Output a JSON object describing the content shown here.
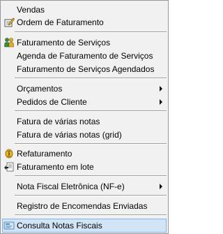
{
  "menu": {
    "items": [
      {
        "label": "Vendas"
      },
      {
        "label": "Ordem de Faturamento",
        "icon": "edit-document-icon"
      },
      {
        "label": "Faturamento de Serviços",
        "icon": "people-icon"
      },
      {
        "label": "Agenda de Faturamento de Serviços"
      },
      {
        "label": "Faturamento de Serviços Agendados"
      },
      {
        "label": "Orçamentos",
        "submenu": true
      },
      {
        "label": "Pedidos de Cliente",
        "submenu": true
      },
      {
        "label": "Fatura de várias notas"
      },
      {
        "label": "Fatura de várias notas (grid)"
      },
      {
        "label": "Refaturamento",
        "icon": "refresh-coin-icon"
      },
      {
        "label": "Faturamento em lote",
        "icon": "batch-document-icon"
      },
      {
        "label": "Nota Fiscal Eletrônica (NF-e)",
        "submenu": true
      },
      {
        "label": "Registro de Encomendas Enviadas"
      },
      {
        "label": "Consulta Notas Fiscais",
        "icon": "search-invoice-icon",
        "highlighted": true
      }
    ]
  },
  "colors": {
    "background": "#f1f1f1",
    "highlight": "#d1e5f7",
    "highlight_border": "#7eb4ea"
  }
}
